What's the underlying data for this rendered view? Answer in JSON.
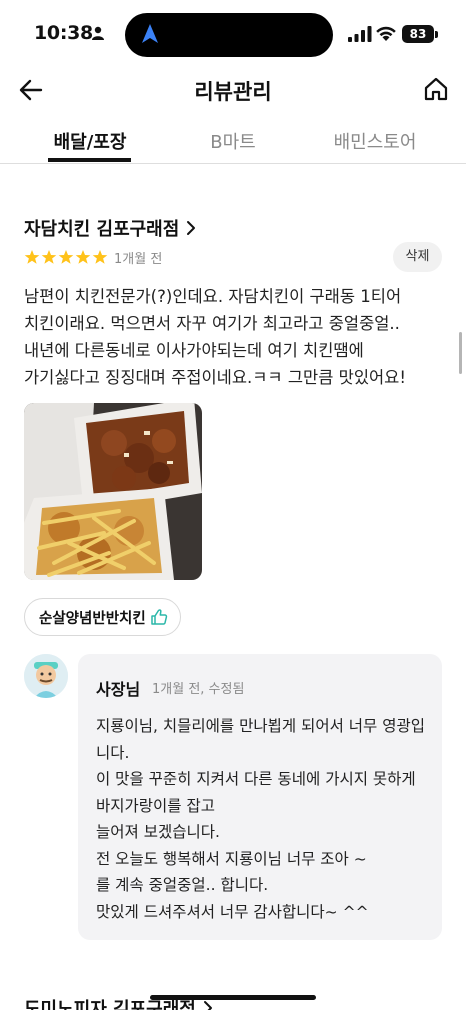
{
  "status": {
    "time": "10:38",
    "battery": "83"
  },
  "header": {
    "title": "리뷰관리"
  },
  "tabs": [
    {
      "label": "배달/포장"
    },
    {
      "label": "B마트"
    },
    {
      "label": "배민스토어"
    }
  ],
  "review": {
    "store_name": "자담치킨 김포구래점",
    "rating": 5,
    "date": "1개월 전",
    "delete_label": "삭제",
    "text": "남편이 치킨전문가(?)인데요. 자담치킨이 구래동 1티어 치킨이래요. 먹으면서 자꾸 여기가 최고라고 중얼중얼.. 내년에 다른동네로 이사가야되는데 여기 치킨땜에 가기싫다고 징징대며 주접이네요.ㅋㅋ 그만큼 맛있어요!",
    "menu_chip": "순살양념반반치킨"
  },
  "reply": {
    "owner_name": "사장님",
    "date": "1개월 전, 수정됨",
    "text": "지룡이님,  치믈리에를 만나뵙게 되어서 너무 영광입니다.\n이 맛을 꾸준히 지켜서 다른 동네에 가시지 못하게 바지가랑이를 잡고\n늘어져 보겠습니다.\n전 오늘도 행복해서 지룡이님 너무 조아 ~\n를 계속 중얼중얼..  합니다.\n맛있게 드셔주셔서 너무 감사합니다~  ^^"
  },
  "next_review": {
    "store_name": "도미노피자 김포구래점"
  },
  "colors": {
    "star": "#ffc21a",
    "accent": "#111111",
    "muted": "#8a8a8a",
    "reply_bg": "#f3f3f5"
  }
}
